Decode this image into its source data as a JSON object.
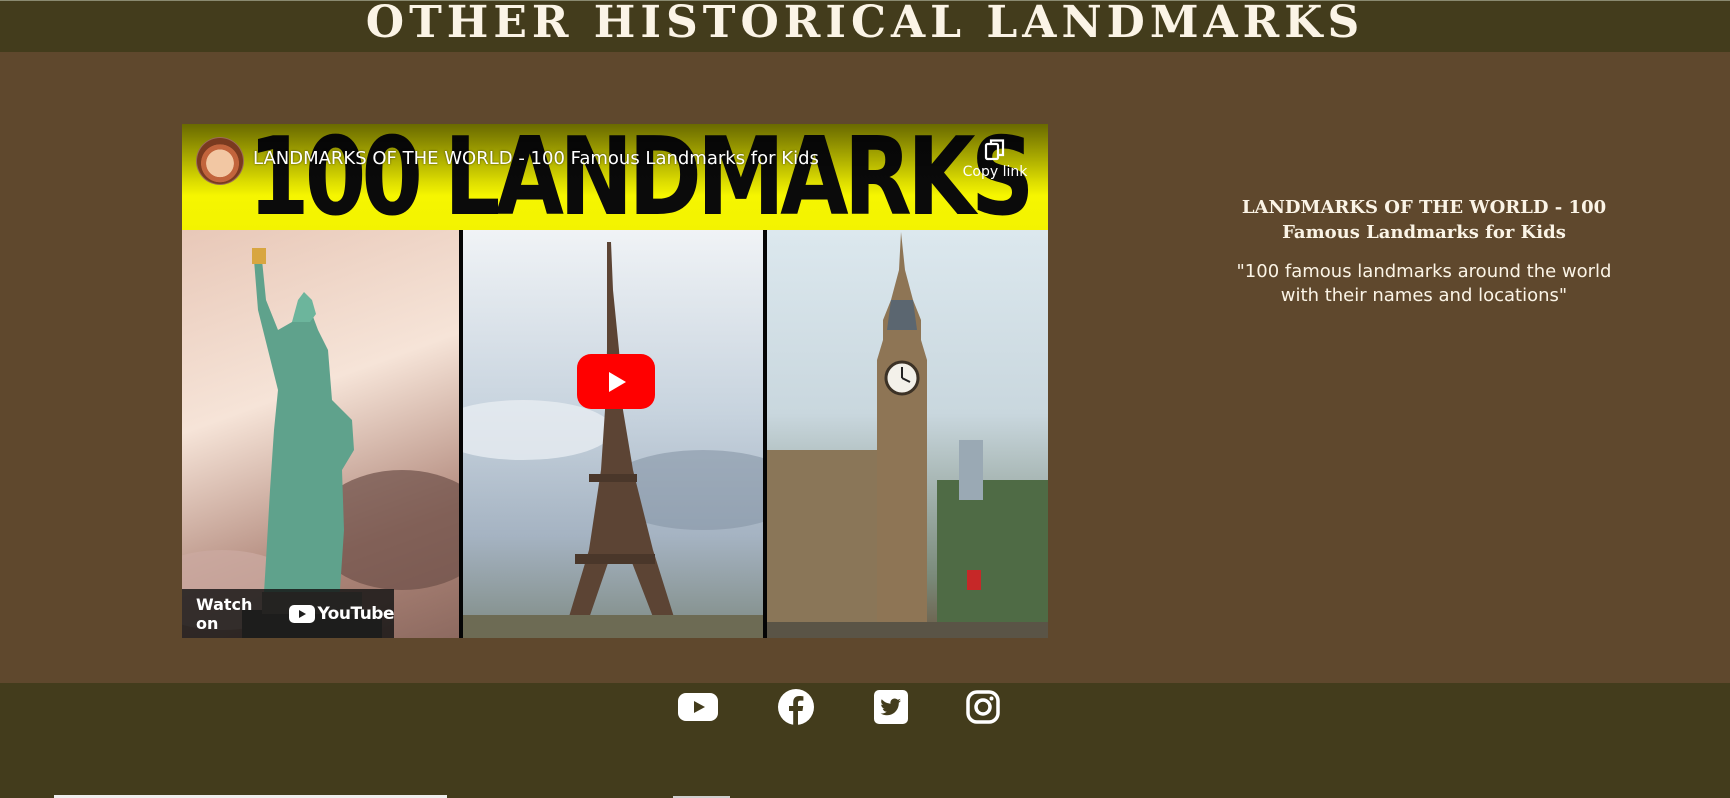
{
  "header": {
    "title": "OTHER HISTORICAL LANDMARKS"
  },
  "video": {
    "thumbnail_banner_text": "100 LANDMARKS",
    "title": "LANDMARKS OF THE WORLD - 100 Famous Landmarks for Kids",
    "copy_link_label": "Copy link",
    "watch_on_label": "Watch on",
    "youtube_logo_text": "YouTube",
    "panels": [
      "statue-of-liberty",
      "eiffel-tower",
      "big-ben"
    ]
  },
  "side": {
    "title": "LANDMARKS OF THE WORLD - 100 Famous Landmarks for Kids",
    "description": "\"100 famous landmarks around the world with their names and locations\""
  },
  "footer": {
    "social_icons": [
      "youtube-icon",
      "facebook-icon",
      "twitter-icon",
      "instagram-icon"
    ]
  },
  "colors": {
    "header_bg": "#433c1c",
    "main_bg": "#5f482d",
    "footer_bg": "#433c1c",
    "text": "#fbf4e6",
    "youtube_red": "#ff0000",
    "banner_yellow": "#f7f700"
  }
}
